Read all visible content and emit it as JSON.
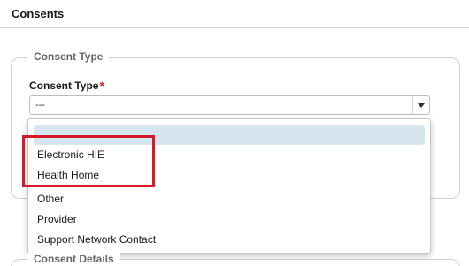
{
  "page": {
    "title": "Consents"
  },
  "consent_type_section": {
    "legend": "Consent Type",
    "field_label": "Consent Type",
    "required_marker": "*",
    "select": {
      "value": "---"
    },
    "options": [
      {
        "label": "---",
        "selected": true
      },
      {
        "label": "Electronic HIE",
        "selected": false
      },
      {
        "label": "Health Home",
        "selected": false
      },
      {
        "label": "Other",
        "selected": false
      },
      {
        "label": "Provider",
        "selected": false
      },
      {
        "label": "Support Network Contact",
        "selected": false
      }
    ]
  },
  "consent_details_section": {
    "legend": "Consent Details"
  },
  "colors": {
    "required": "#e01f1f",
    "selected_option_bg": "#d5e6ef",
    "highlight_box": "#d71a2a"
  },
  "icons": {
    "select_caret": "caret-down-icon"
  }
}
